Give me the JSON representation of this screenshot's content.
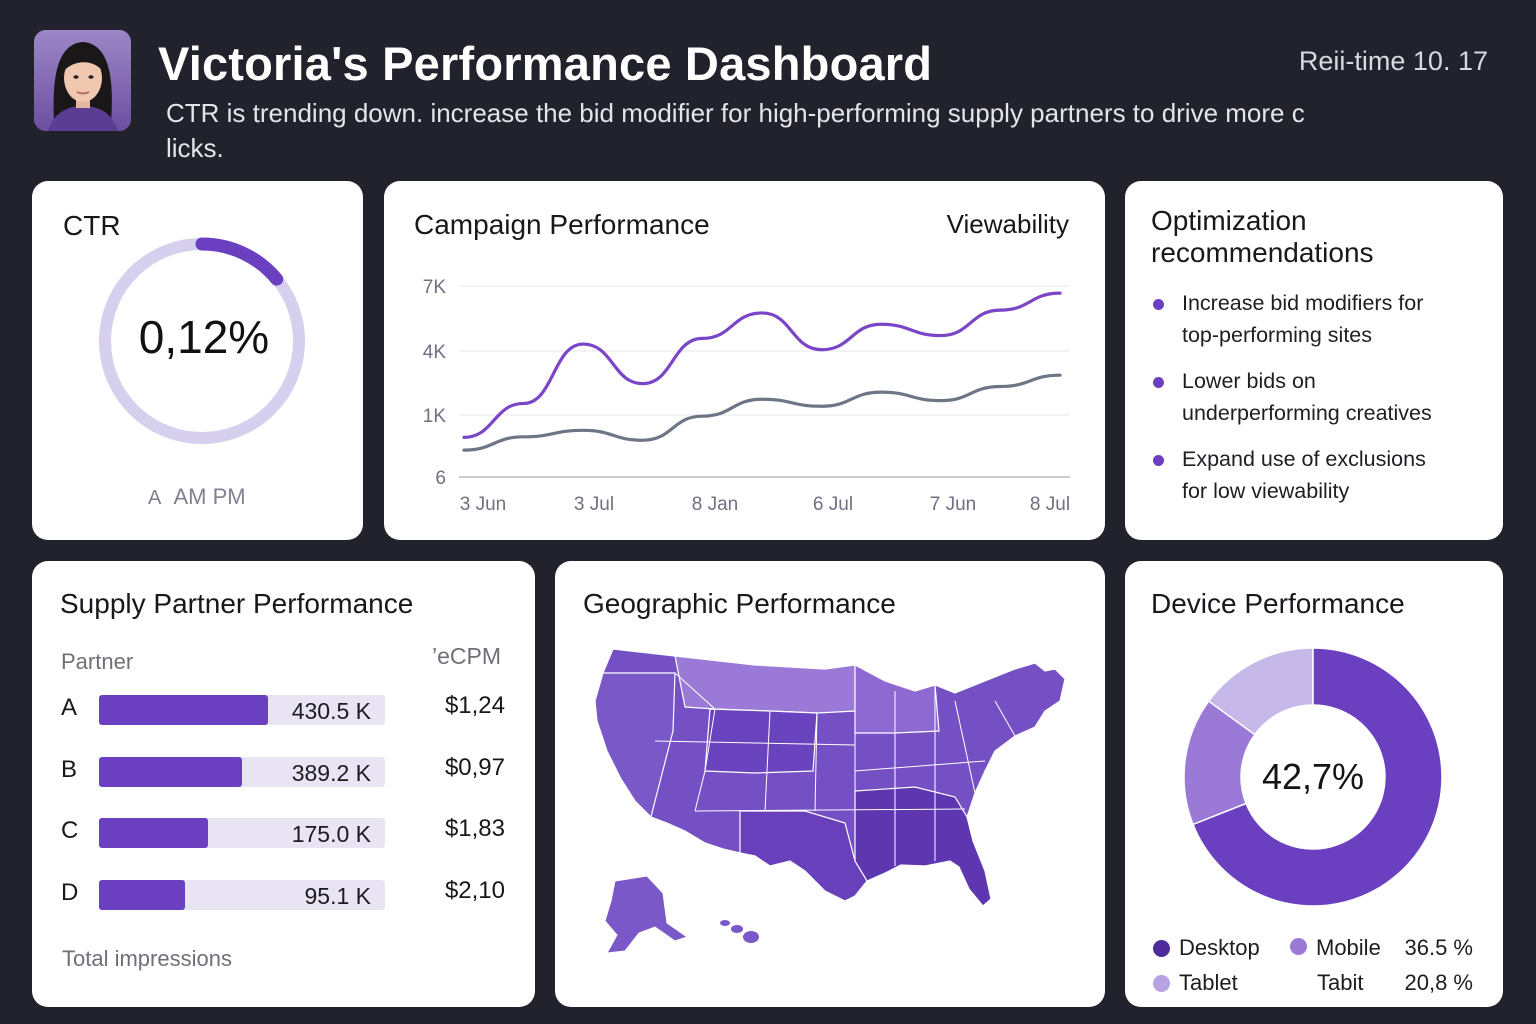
{
  "header": {
    "title": "Victoria's Performance Dashboard",
    "clock": "Reii-time 10. 17",
    "subtitle_line1": "CTR is trending down. increase the bid modifier for high-performing supply partners to drive more c",
    "subtitle_line2": "licks."
  },
  "ctr": {
    "title": "CTR",
    "value": "0,12%",
    "progress": 0.14,
    "foot_prefix": "A",
    "foot_text": "AM PM"
  },
  "campaign": {
    "title": "Campaign Performance",
    "right_label": "Viewability"
  },
  "chart_data": {
    "type": "line",
    "x": [
      "3 Jun",
      "3 Jul",
      "8 Jan",
      "6 Jul",
      "7 Jun",
      "8 Jul"
    ],
    "y_ticks": [
      "7K",
      "4K",
      "1K",
      "6"
    ],
    "ylim": [
      0,
      7000
    ],
    "grid": true,
    "series": [
      {
        "color": "#7a46c7",
        "values": [
          1400,
          2600,
          4700,
          3300,
          4900,
          5800,
          4500,
          5400,
          5000,
          5900,
          6500
        ]
      },
      {
        "color": "#6e7585",
        "values": [
          950,
          1420,
          1650,
          1300,
          2150,
          2750,
          2500,
          3000,
          2700,
          3200,
          3600
        ]
      }
    ]
  },
  "recs": {
    "title_line1": "Optimization",
    "title_line2": "recommendations",
    "items": [
      {
        "line1": "Increase bid modifiers for",
        "line2": "top-performing sites"
      },
      {
        "line1": "Lower bids on",
        "line2": "underperforming creatives"
      },
      {
        "line1": "Expand use of exclusions",
        "line2": "for low viewability"
      }
    ]
  },
  "supply": {
    "title": "Supply Partner Performance",
    "col_partner": "Partner",
    "col_ecpm": "’eCPM",
    "rows": [
      {
        "partner": "A",
        "impressions": "430.5 K",
        "fill": 0.59,
        "ecpm": "$1,24"
      },
      {
        "partner": "B",
        "impressions": "389.2 K",
        "fill": 0.5,
        "ecpm": "$0,97"
      },
      {
        "partner": "C",
        "impressions": "175.0 K",
        "fill": 0.38,
        "ecpm": "$1,83"
      },
      {
        "partner": "D",
        "impressions": "95.1 K",
        "fill": 0.3,
        "ecpm": "$2,10"
      }
    ],
    "total_label": "Total impressions"
  },
  "geo": {
    "title": "Geographic Performance"
  },
  "device": {
    "title": "Device Performance",
    "center_value": "42,7%",
    "slices": [
      {
        "label": "Desktop",
        "share": 0.69,
        "color": "#6a3fc0"
      },
      {
        "label": "Mobile",
        "share": 0.16,
        "color": "#9a7ad6"
      },
      {
        "label": "Tablet",
        "share": 0.15,
        "color": "#c7b8ea"
      }
    ],
    "legend": {
      "desktop": "Desktop",
      "mobile": "Mobile",
      "mobile_value": "36.5 %",
      "tablet": "Tablet",
      "tablet_alt": "Tabit",
      "tablet_value": "20,8 %"
    }
  }
}
